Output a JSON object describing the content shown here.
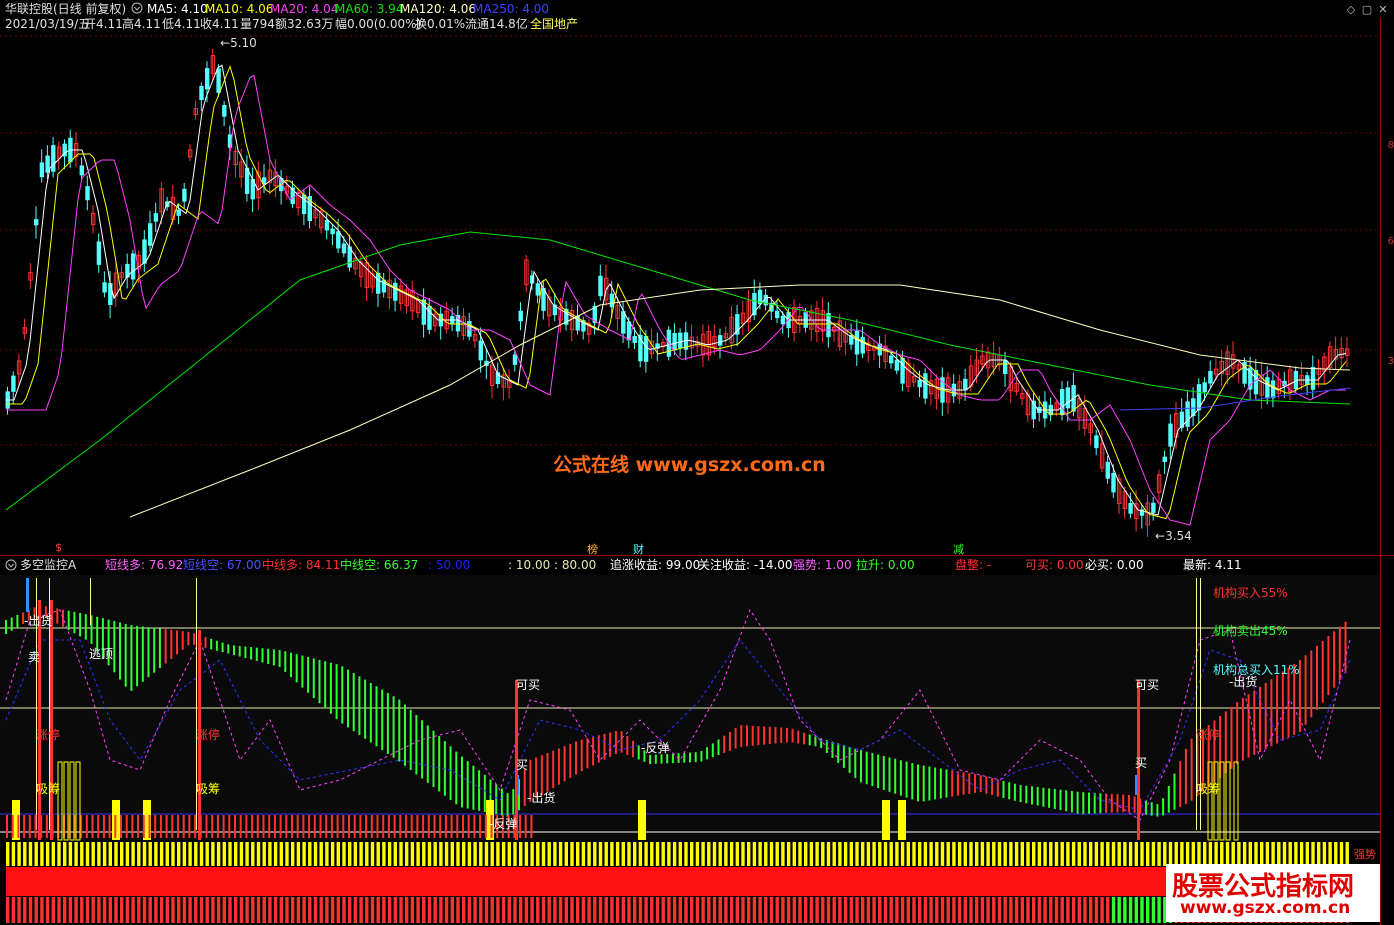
{
  "colors": {
    "bg": "#000000",
    "up": "#ff3232",
    "down": "#54ffff",
    "ma5": "#ffffff",
    "ma10": "#ffff00",
    "ma20": "#ff40ff",
    "ma60": "#00e600",
    "ma120": "#ffffc0",
    "ma250": "#4040ff",
    "grid": "#800000",
    "panel_bg": "#101010",
    "short_long": "#ff3232",
    "short_short": "#30ff30",
    "yellow": "#ffff00",
    "cyan": "#54ffff"
  },
  "header": {
    "title": "华联控股(日线 前复权)",
    "ma5": "MA5: 4.10",
    "ma10": "MA10: 4.06",
    "ma20": "MA20: 4.04",
    "ma60": "MA60: 3.94",
    "ma120": "MA120: 4.06",
    "ma250": "MA250: 4.00"
  },
  "info_line": {
    "date": "2021/03/19/五",
    "open": "开4.11",
    "high": "高4.11",
    "low": "低4.11",
    "close": "收4.11",
    "volume": "量794",
    "amount": "额32.63万",
    "change": "幅0.00(0.00%)",
    "turnover": "换0.01%",
    "float": "流通14.8亿",
    "sector": "全国地产"
  },
  "price_labels": {
    "high": "5.10",
    "low": "3.54"
  },
  "right_axis": [
    "8",
    "6",
    "3"
  ],
  "markers": {
    "m1": "$",
    "m2": "榜",
    "m3": "财",
    "m4": "减"
  },
  "indicator": {
    "name": "多空监控A",
    "short_long": "短线多: 76.92",
    "short_short": "短线空: 67.00",
    "mid_long": "中线多: 84.11",
    "mid_short": "中线空: 66.37",
    "v50": ": 50.00",
    "v10_80": ": 10.00 : 80.00",
    "chase": "追涨收益: 99.00",
    "watch": "关注收益: -14.00",
    "strength": "强势: 1.00",
    "pull": "拉升: 0.00",
    "consolidate": "盘整: -",
    "can_buy": "可买: 0.00",
    "must_buy": "必买: 0.00",
    "latest": "最新: 4.11"
  },
  "panel_labels": {
    "inst_buy": "机构买入55%",
    "inst_sell": "机构卖出45%",
    "inst_total": "机构总买入11%",
    "strong": "强势",
    "chuhuo": "出货",
    "mai": "卖",
    "taoding": "逃顶",
    "zhangting": "涨停",
    "xichou": "吸筹",
    "kemai": "可买",
    "mai_buy": "买",
    "fantan": "反弹"
  },
  "watermarks": {
    "center": "公式在线  www.gszx.com.cn",
    "corner_cn": "股票公式指标网",
    "corner_url": "www.gszx.com.cn"
  }
}
